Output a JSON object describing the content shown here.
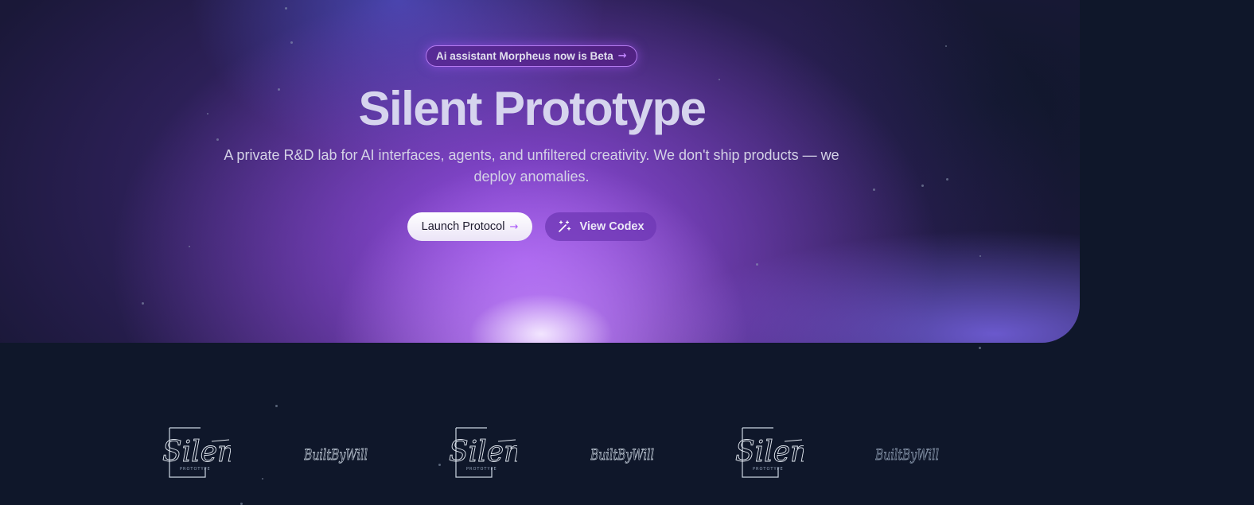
{
  "banner": {
    "text": "Ai assistant Morpheus now is Beta",
    "arrow": "→"
  },
  "hero": {
    "title": "Silent Prototype",
    "subtitle": "A private R&D lab for AI interfaces, agents, and unfiltered creativity. We don't ship products — we deploy anomalies."
  },
  "actions": {
    "primary_label": "Launch Protocol",
    "primary_arrow": "→",
    "secondary_label": "View Codex",
    "secondary_icon": "magic-wand-icon"
  },
  "logos": [
    {
      "name": "silent-prototype-logo",
      "text": "Silent",
      "subtext": "PROTOTYPE"
    },
    {
      "name": "builtbywill-logo",
      "text": "BuiltByWill"
    },
    {
      "name": "silent-prototype-logo",
      "text": "Silent",
      "subtext": "PROTOTYPE"
    },
    {
      "name": "builtbywill-logo",
      "text": "BuiltByWill"
    },
    {
      "name": "silent-prototype-logo",
      "text": "Silent",
      "subtext": "PROTOTYPE"
    },
    {
      "name": "builtbywill-logo",
      "text": "BuiltByWill"
    }
  ],
  "colors": {
    "background": "#0f172a",
    "accent": "#a855f7",
    "glow": "#c084fc"
  }
}
